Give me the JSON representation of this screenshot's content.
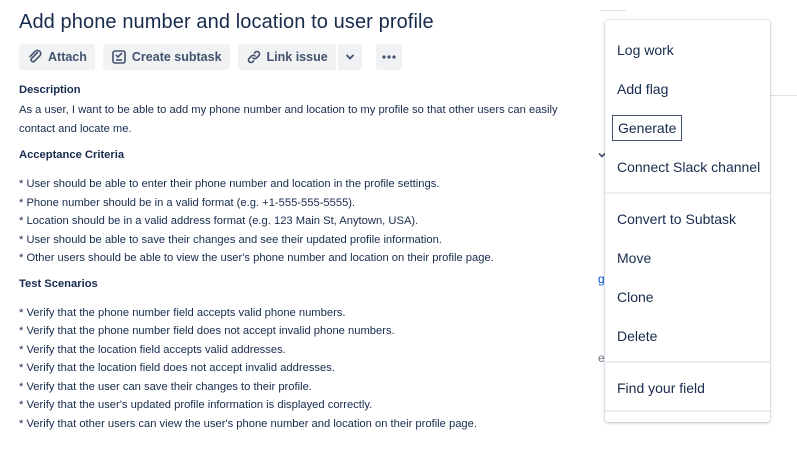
{
  "issue": {
    "title": "Add phone number and location to user profile"
  },
  "toolbar": {
    "attach_label": "Attach",
    "create_subtask_label": "Create subtask",
    "link_issue_label": "Link issue"
  },
  "description": {
    "heading": "Description",
    "text": "As a user, I want to be able to add my phone number and location to my profile so that other users can easily contact and locate me.",
    "acceptance_heading": "Acceptance Criteria",
    "acceptance_items": [
      "* User should be able to enter their phone number and location in the profile settings.",
      "* Phone number should be in a valid format (e.g. +1-555-555-5555).",
      "* Location should be in a valid address format (e.g. 123 Main St, Anytown, USA).",
      "* User should be able to save their changes and see their updated profile information.",
      "* Other users should be able to view the user's phone number and location on their profile page."
    ],
    "test_heading": "Test Scenarios",
    "test_items": [
      "* Verify that the phone number field accepts valid phone numbers.",
      "* Verify that the phone number field does not accept invalid phone numbers.",
      "* Verify that the location field accepts valid addresses.",
      "* Verify that the location field does not accept invalid addresses.",
      "* Verify that the user can save their changes to their profile.",
      "* Verify that the user's updated profile information is displayed correctly.",
      "* Verify that other users can view the user's phone number and location on their profile page."
    ]
  },
  "background": {
    "fragment_g": "g",
    "fragment_e": "e"
  },
  "menu": {
    "items": [
      "Log work",
      "Add flag",
      "Generate",
      "Connect Slack channel",
      "Convert to Subtask",
      "Move",
      "Clone",
      "Delete",
      "Find your field"
    ]
  },
  "colors": {
    "text": "#172b4d",
    "button_bg": "#f1f2f4",
    "button_text": "#42526e",
    "separator": "#ebecf0"
  }
}
